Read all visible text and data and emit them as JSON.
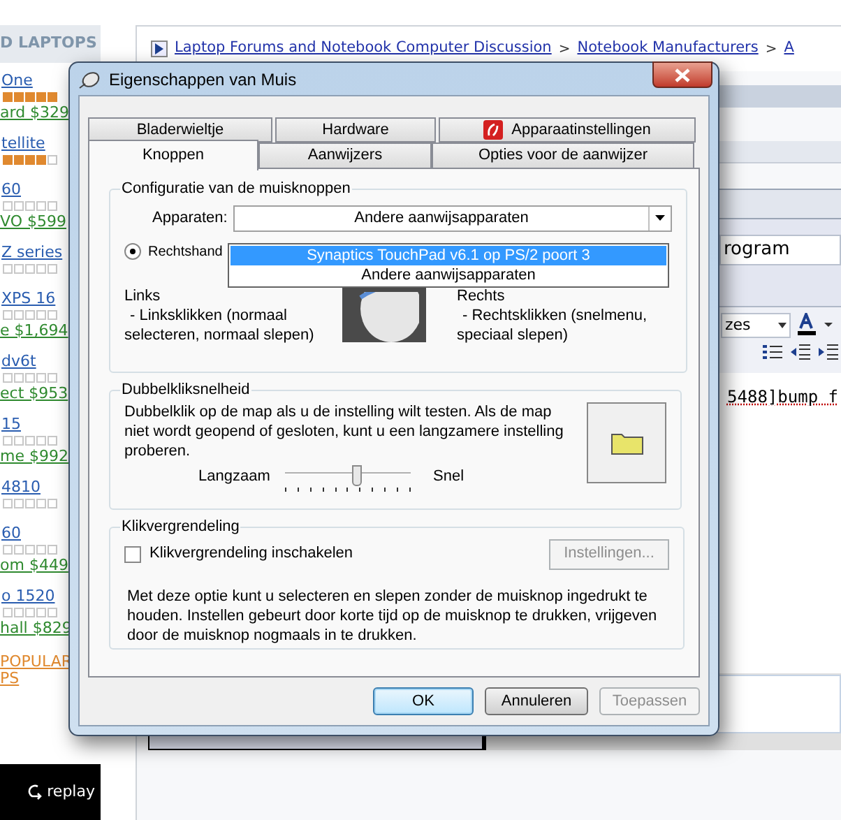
{
  "page": {
    "sidebar": {
      "heading": "D LAPTOPS",
      "items": [
        {
          "name": "One",
          "stars": 5,
          "price": "ard $329"
        },
        {
          "name": "tellite",
          "stars": 4
        },
        {
          "name": "60",
          "stars": 0,
          "price": "VO $599"
        },
        {
          "name": "Z series",
          "stars": 0
        },
        {
          "name": "XPS 16",
          "stars": 0,
          "price": "e $1,694"
        },
        {
          "name": "dv6t",
          "stars": 0,
          "price": "ect $953"
        },
        {
          "name": "15",
          "stars": 0,
          "price": "me $992"
        },
        {
          "name": "4810",
          "stars": 0
        },
        {
          "name": "60",
          "stars": 0,
          "price": "om $449"
        },
        {
          "name": "o 1520",
          "stars": 0,
          "price": "hall $829"
        }
      ],
      "more_link": [
        "POPULAR",
        "PS"
      ],
      "replay": "replay"
    },
    "breadcrumb": {
      "links": [
        "Laptop Forums and Notebook Computer Discussion",
        "Notebook Manufacturers",
        "A"
      ],
      "separator": ">"
    },
    "editor": {
      "title_field": "rogram",
      "font_size": "zes",
      "body_text": "5488]bump f"
    }
  },
  "dialog": {
    "title": "Eigenschappen van Muis",
    "tabs_back_row": [
      {
        "label": "Bladerwieltje",
        "selected": false,
        "icon": false
      },
      {
        "label": "Hardware",
        "selected": false,
        "icon": false
      },
      {
        "label": "Apparaatinstellingen",
        "selected": false,
        "icon": true
      }
    ],
    "tabs_front_row": [
      {
        "label": "Knoppen",
        "selected": true,
        "icon": false
      },
      {
        "label": "Aanwijzers",
        "selected": false,
        "icon": false
      },
      {
        "label": "Opties voor de aanwijzer",
        "selected": false,
        "icon": false
      }
    ],
    "buttons_group": {
      "title": "Configuratie van de muisknoppen",
      "device_label": "Apparaten:",
      "device_value": "Andere aanwijsapparaten",
      "dropdown_options": [
        {
          "label": "Synaptics TouchPad v6.1 op PS/2 poort 3",
          "selected": true
        },
        {
          "label": "Andere aanwijsapparaten",
          "selected": false
        }
      ],
      "radio": {
        "label": "Rechtshand",
        "selected": true
      },
      "left_title": "Links",
      "left_text": "- Linksklikken (normaal selecteren, normaal slepen)",
      "right_title": "Rechts",
      "right_text": "- Rechtsklikken (snelmenu, speciaal slepen)"
    },
    "double_click_group": {
      "title": "Dubbelkliksnelheid",
      "text": "Dubbelklik op de map als u de instelling wilt testen. Als de map niet wordt geopend of gesloten, kunt u een langzamere instelling proberen.",
      "slow_label": "Langzaam",
      "fast_label": "Snel",
      "level": 0.57
    },
    "click_lock_group": {
      "title": "Klikvergrendeling",
      "checkbox": {
        "label": "Klikvergrendeling inschakelen",
        "checked": false
      },
      "settings_button": {
        "label": "Instellingen...",
        "disabled": true
      },
      "text": "Met deze optie kunt u selecteren en slepen zonder de muisknop ingedrukt te houden. Instellen gebeurt door korte tijd op de muisknop te drukken, vrijgeven door de muisknop nogmaals in te drukken."
    },
    "buttons": [
      {
        "label": "OK",
        "default": true,
        "disabled": false
      },
      {
        "label": "Annuleren",
        "default": false,
        "disabled": false
      },
      {
        "label": "Toepassen",
        "default": false,
        "disabled": true
      }
    ]
  }
}
